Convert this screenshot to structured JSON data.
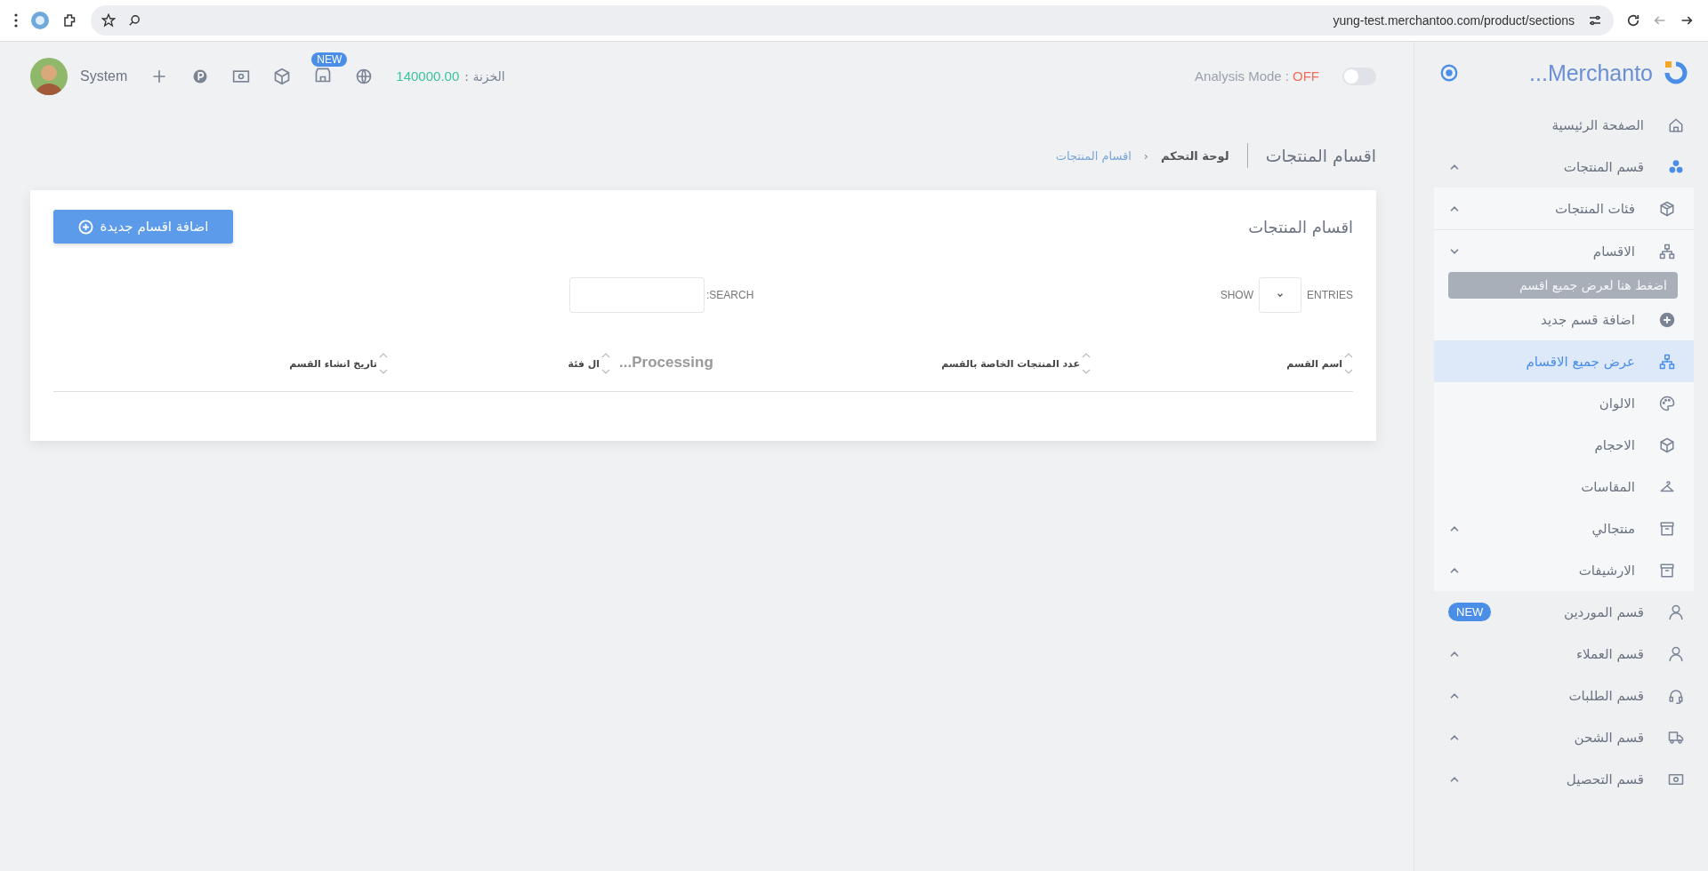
{
  "browser": {
    "url": "yung-test.merchantoo.com/product/sections"
  },
  "topbar": {
    "user": "System",
    "new_badge": "NEW",
    "treasury_label": "الخزنة :",
    "treasury_value": "140000.00",
    "analysis_label": "Analysis Mode :",
    "analysis_value": "OFF",
    "analysis_on": false
  },
  "sidebar": {
    "brand": "...Merchanto",
    "tooltip": "اضغط هنا لعرض جميع اقسم",
    "items": [
      {
        "label": "الصفحة الرئيسية",
        "kind": "home",
        "selected": false
      },
      {
        "label": "قسم المنتجات",
        "kind": "cubes",
        "selected": false,
        "caret_up": true,
        "children": [
          {
            "label": "فئات المنتجات",
            "kind": "box",
            "selected": false,
            "caret_up": true
          },
          {
            "label": "الاقسام",
            "kind": "sitemap",
            "selected": false,
            "caret_up": false,
            "children": [
              {
                "label": "اضافة قسم جديد",
                "kind": "plus",
                "selected": false
              },
              {
                "label": "عرض جميع الاقسام",
                "kind": "sitemap",
                "selected": true
              }
            ]
          },
          {
            "label": "الالوان",
            "kind": "palette",
            "selected": false
          },
          {
            "label": "الاحجام",
            "kind": "cube",
            "selected": false
          },
          {
            "label": "المقاسات",
            "kind": "hanger",
            "selected": false
          },
          {
            "label": "منتجالي",
            "kind": "archive",
            "selected": false,
            "caret_up": true
          },
          {
            "label": "الارشيفات",
            "kind": "archive",
            "selected": false,
            "caret_up": true
          }
        ]
      },
      {
        "label": "قسم الموردين",
        "kind": "user",
        "selected": false,
        "badge": "NEW"
      },
      {
        "label": "قسم العملاء",
        "kind": "user",
        "selected": false,
        "caret_up": true
      },
      {
        "label": "قسم الطلبات",
        "kind": "headset",
        "selected": false,
        "caret_up": true
      },
      {
        "label": "قسم الشحن",
        "kind": "truck",
        "selected": false,
        "caret_up": true
      },
      {
        "label": "قسم التحصيل",
        "kind": "money",
        "selected": false,
        "caret_up": true
      }
    ]
  },
  "page": {
    "title": "اقسام المنتجات",
    "breadcrumb_separator": "‹",
    "breadcrumb": [
      {
        "label": "لوحة التحكم",
        "current": false
      },
      {
        "label": "اقسام المنتجات",
        "current": true
      }
    ]
  },
  "card": {
    "title": "اقسام المنتجات",
    "add_button": "اضافة اقسام جديدة",
    "show_label": "SHOW",
    "entries_label": "ENTRIES",
    "search_label": "SEARCH:",
    "columns": [
      "اسم القسم",
      "عدد المنتجات الخاصة بالقسم",
      "ال فئة",
      "تاريخ انشاء القسم"
    ],
    "processing": "Processing..."
  }
}
